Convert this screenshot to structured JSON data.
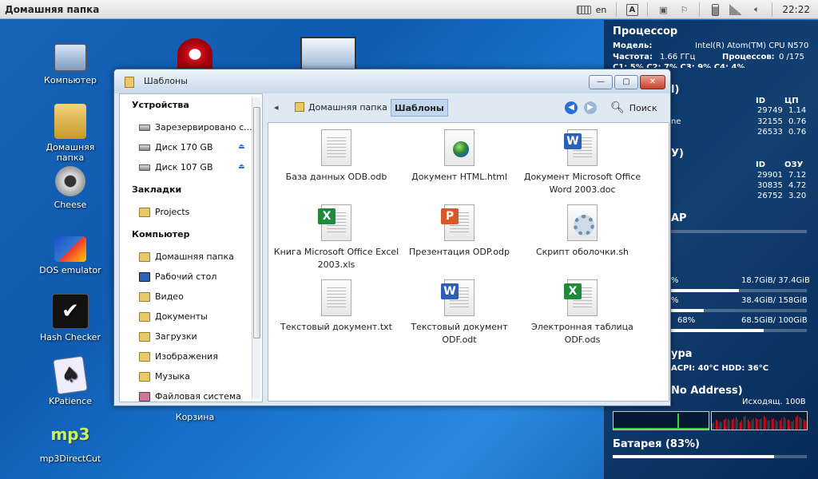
{
  "top_panel": {
    "title": "Домашняя папка",
    "lang": "en",
    "clock": "22:22"
  },
  "desktop_icons": [
    {
      "label": "Компьютер"
    },
    {
      "label": "Домашняя папка"
    },
    {
      "label": "Cheese"
    },
    {
      "label": "DOS emulator"
    },
    {
      "label": "Hash Checker"
    },
    {
      "label": "KPatience"
    },
    {
      "label": "mp3DirectCut"
    },
    {
      "label": "Корзина"
    }
  ],
  "conky": {
    "cpu_title": "Процессор",
    "model_label": "Модель:",
    "model_value": "Intel(R) Atom(TM) CPU N570",
    "freq_label": "Частота:",
    "freq_value": "1.66 ГГц",
    "procs_label": "Процессов:",
    "procs_value": "0 /175",
    "cstates": "C1: 5%  C2: 7%  C3: 9%  C4: 4%",
    "top_cpu_title_frag": "l)",
    "col_id": "ID",
    "col_cpu": "ЦП",
    "top_cpu_rows": [
      {
        "name": "",
        "id": "29749",
        "val": "1.14"
      },
      {
        "name": "ne",
        "id": "32155",
        "val": "0.76"
      },
      {
        "name": "",
        "id": "26533",
        "val": "0.76"
      }
    ],
    "top_mem_title_frag": "У)",
    "col_mem": "ОЗУ",
    "top_mem_rows": [
      {
        "id": "29901",
        "val": "7.12"
      },
      {
        "id": "30835",
        "val": "4.72"
      },
      {
        "id": "26752",
        "val": "3.20"
      }
    ],
    "ram_title_frag": "АР",
    "disks": [
      {
        "pct": "%",
        "usage": "18.7GiB/ 37.4GiB",
        "fill": 0.5
      },
      {
        "pct": "%",
        "usage": "38.4GiB/ 158GiB",
        "fill": 0.24
      },
      {
        "pct": "68%",
        "usage": "68.5GiB/ 100GiB",
        "fill": 0.68
      }
    ],
    "temp_title_frag": "ура",
    "temp_text": "ACPI:  40°C  HDD:  36°C",
    "net_title": "No Address)",
    "net_out": "Исходящ. 100B",
    "battery_title": "Батарея (83%)",
    "battery_fill": 0.83
  },
  "window": {
    "title": "Шаблоны",
    "btn_minimize": "—",
    "btn_maximize": "▢",
    "btn_close": "✕",
    "sidebar": {
      "devices_head": "Устройства",
      "devices": [
        "Зарезервировано с...",
        "Диск 170 GB",
        "Диск 107 GB"
      ],
      "bookmarks_head": "Закладки",
      "bookmarks": [
        "Projects"
      ],
      "computer_head": "Компьютер",
      "computer": [
        "Домашняя папка",
        "Рабочий стол",
        "Видео",
        "Документы",
        "Загрузки",
        "Изображения",
        "Музыка",
        "Файловая система"
      ]
    },
    "toolbar": {
      "back_arrow": "◂",
      "crumb_home": "Домашняя папка",
      "crumb_current": "Шаблоны",
      "search_label": "Поиск"
    },
    "files": [
      {
        "name": "База данных ODB.odb",
        "type": "plain"
      },
      {
        "name": "Документ HTML.html",
        "type": "html"
      },
      {
        "name": "Документ Microsoft Office Word 2003.doc",
        "type": "word"
      },
      {
        "name": "Книга Microsoft Office Excel 2003.xls",
        "type": "excel"
      },
      {
        "name": "Презентация ODP.odp",
        "type": "ppt"
      },
      {
        "name": "Скрипт оболочки.sh",
        "type": "script"
      },
      {
        "name": "Текстовый документ.txt",
        "type": "plain"
      },
      {
        "name": "Текстовый документ ODF.odt",
        "type": "word"
      },
      {
        "name": "Электронная таблица ODF.ods",
        "type": "excel"
      }
    ]
  },
  "colors": {
    "word": "#2b5fb8",
    "excel": "#1f8a3a",
    "ppt": "#d9582b",
    "accent": "#2b6fd6"
  }
}
